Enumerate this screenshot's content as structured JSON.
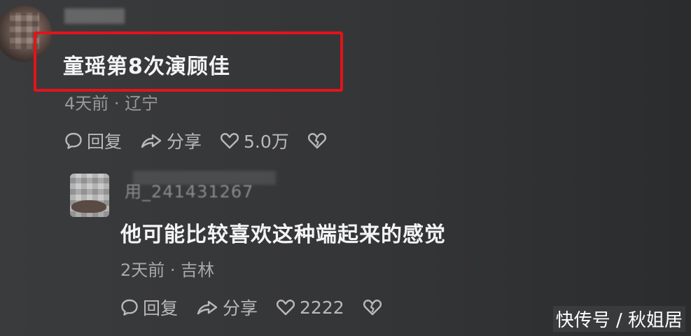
{
  "comments": [
    {
      "username": "",
      "text": "童瑶第8次演顾佳",
      "meta": "4天前 · 辽宁",
      "actions": {
        "reply": "回复",
        "share": "分享",
        "likes": "5.0万"
      }
    },
    {
      "username": "用_241431267",
      "text": "他可能比较喜欢这种端起来的感觉",
      "meta": "2天前 · 吉林",
      "actions": {
        "reply": "回复",
        "share": "分享",
        "likes": "2222"
      }
    }
  ],
  "watermark": "快传号 / 秋姐居",
  "colors": {
    "highlight": "#e2141b",
    "background": "#353638",
    "text": "#f4f4f4",
    "meta": "#a9a9a9"
  },
  "icons": [
    "comment-bubble-icon",
    "share-arrow-icon",
    "heart-icon",
    "broken-heart-icon"
  ]
}
